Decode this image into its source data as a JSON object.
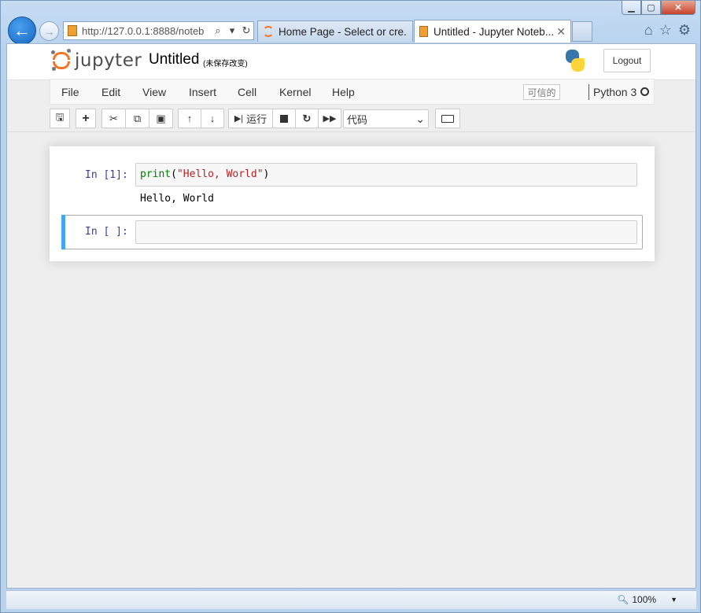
{
  "browser": {
    "address_url": "http://127.0.0.1:8888/noteb",
    "address_host_visible": "127.0.0.1",
    "tabs": [
      {
        "title": "Home Page - Select or cre...",
        "active": false
      },
      {
        "title": "Untitled - Jupyter Noteb...",
        "active": true
      }
    ],
    "zoom_level": "100%"
  },
  "jupyter": {
    "logo_text": "jupyter",
    "notebook_title": "Untitled",
    "save_status": "(未保存改变)",
    "logout_label": "Logout",
    "menu": [
      "File",
      "Edit",
      "View",
      "Insert",
      "Cell",
      "Kernel",
      "Help"
    ],
    "trusted_label": "可信的",
    "kernel_name": "Python 3",
    "toolbar": {
      "run_label": "运行",
      "cell_type": "代码",
      "cell_type_options": [
        "代码"
      ]
    },
    "cells": [
      {
        "prompt": "In [1]:",
        "code_fn": "print",
        "code_open": "(",
        "code_str": "\"Hello, World\"",
        "code_close": ")",
        "output": "Hello, World"
      },
      {
        "prompt": "In [ ]:",
        "code": ""
      }
    ]
  },
  "colors": {
    "jupyter_orange": "#f37626",
    "prompt_blue": "#303f9f",
    "selected_cell_bar": "#42a5f5",
    "code_keyword": "#008000",
    "code_string": "#ba2121"
  }
}
